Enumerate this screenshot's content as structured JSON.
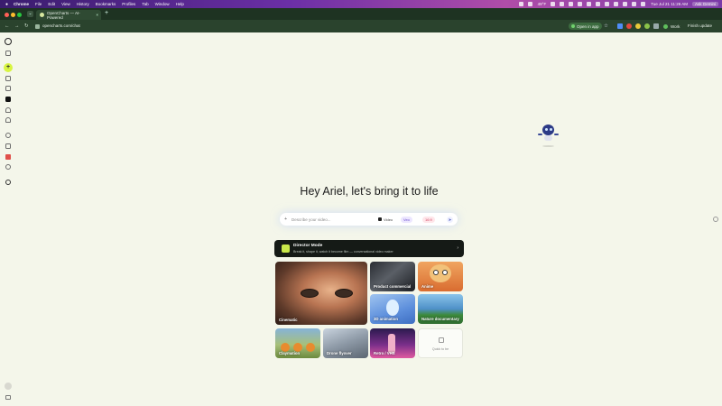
{
  "menubar": {
    "apple": "",
    "items": [
      "Chrome",
      "File",
      "Edit",
      "View",
      "History",
      "Bookmarks",
      "Profiles",
      "Tab",
      "Window",
      "Help"
    ],
    "status_left": "49°F",
    "clock": "Tue Jul 21  11:26 AM",
    "ask": "Ask Gemini"
  },
  "browser": {
    "tab_title": "OpenCharts — AI-Powered",
    "tab_close": "×",
    "new_tab": "+",
    "url": "opencharts.com/chat",
    "open_in_app": "Open in app",
    "profile": "Work",
    "finish_update": "Finish update"
  },
  "sidebar": {
    "new_label": "+"
  },
  "main": {
    "greeting": "Hey Ariel, let's bring it to life",
    "prompt": {
      "plus": "+",
      "placeholder": "Describe your video...",
      "mode_chip": "Video",
      "model_chip": "Veo",
      "ratio_chip": "16:9",
      "send": "➤"
    },
    "director": {
      "title": "Director Mode",
      "description": "Break it, shape it, watch it become film — conversational video maker",
      "chevron": "›"
    },
    "cards": {
      "cinematic": "Cinematic",
      "product": "Product commercial",
      "anime": "Anime",
      "animation3d": "3D animation",
      "nature": "Nature documentary",
      "claymation": "Claymation",
      "drone": "Drone flyover",
      "retro": "Retro / VHS",
      "more": "Quick to be"
    }
  },
  "colors": {
    "accent": "#d8f542",
    "tab_strip": "#1e3322",
    "background": "#f4f6ea"
  }
}
